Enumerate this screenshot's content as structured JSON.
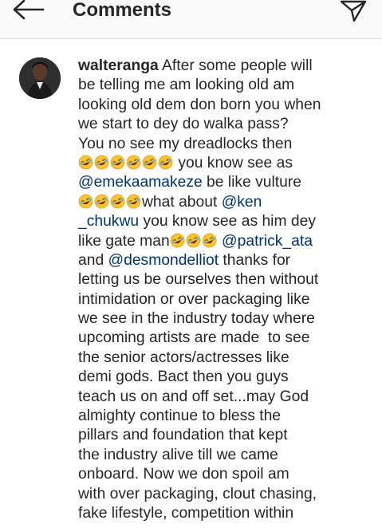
{
  "header": {
    "title": "Comments",
    "back_icon": "arrow-left-icon",
    "send_icon": "paper-plane-icon"
  },
  "comment": {
    "username": "walteranga",
    "avatar_icon": "avatar",
    "emoji_icon": "rolling-on-floor-laughing-emoji",
    "lines": [
      [
        {
          "t": "user",
          "v": "walteranga"
        },
        {
          "t": "text",
          "v": " After some people will"
        }
      ],
      [
        {
          "t": "text",
          "v": "be telling me am looking old am"
        }
      ],
      [
        {
          "t": "text",
          "v": "looking old dem don born you when"
        }
      ],
      [
        {
          "t": "text",
          "v": "we start to dey do walka pass?"
        }
      ],
      [
        {
          "t": "text",
          "v": "You no see my dreadlocks then"
        }
      ],
      [
        {
          "t": "emoji",
          "n": 6
        },
        {
          "t": "text",
          "v": " you know see as"
        }
      ],
      [
        {
          "t": "mention",
          "v": "@emekaamakeze"
        },
        {
          "t": "text",
          "v": " be like vulture"
        }
      ],
      [
        {
          "t": "emoji",
          "n": 4
        },
        {
          "t": "text",
          "v": "what about "
        },
        {
          "t": "mention",
          "v": "@ken"
        }
      ],
      [
        {
          "t": "mention",
          "v": "_chukwu"
        },
        {
          "t": "text",
          "v": " you know see as him dey"
        }
      ],
      [
        {
          "t": "text",
          "v": "like gate man"
        },
        {
          "t": "emoji",
          "n": 3
        },
        {
          "t": "text",
          "v": " "
        },
        {
          "t": "mention",
          "v": "@patrick_ata"
        }
      ],
      [
        {
          "t": "text",
          "v": "and "
        },
        {
          "t": "mention",
          "v": "@desmondelliot"
        },
        {
          "t": "text",
          "v": " thanks for"
        }
      ],
      [
        {
          "t": "text",
          "v": "letting us be ourselves then without"
        }
      ],
      [
        {
          "t": "text",
          "v": "intimidation or over packaging like"
        }
      ],
      [
        {
          "t": "text",
          "v": "we see in the industry today where"
        }
      ],
      [
        {
          "t": "text",
          "v": "upcoming artists are made  to see"
        }
      ],
      [
        {
          "t": "text",
          "v": "the senior actors/actresses like"
        }
      ],
      [
        {
          "t": "text",
          "v": "demi gods. Bact then you guys"
        }
      ],
      [
        {
          "t": "text",
          "v": "teach us on and off set...may God"
        }
      ],
      [
        {
          "t": "text",
          "v": "almighty continue to bless the"
        }
      ],
      [
        {
          "t": "text",
          "v": "pillars and foundation that kept"
        }
      ],
      [
        {
          "t": "text",
          "v": "the industry alive till we came"
        }
      ],
      [
        {
          "t": "text",
          "v": "onboard. Now we don spoil am"
        }
      ],
      [
        {
          "t": "text",
          "v": "with over packaging, clout chasing,"
        }
      ],
      [
        {
          "t": "text",
          "v": "fake lifestyle, competition within"
        }
      ]
    ]
  }
}
